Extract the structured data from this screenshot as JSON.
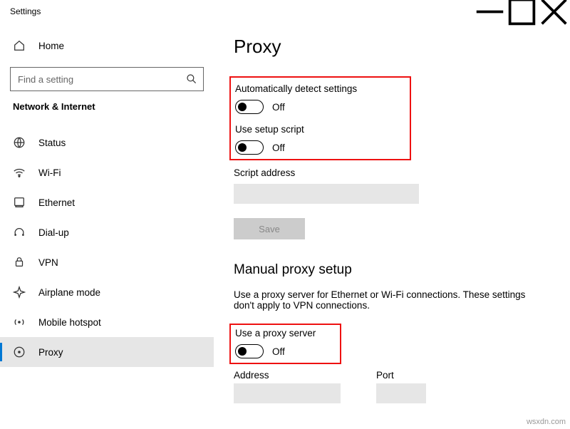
{
  "window": {
    "title": "Settings",
    "min": "minimize",
    "max": "maximize",
    "close": "close"
  },
  "sidebar": {
    "home": "Home",
    "search_placeholder": "Find a setting",
    "group": "Network & Internet",
    "items": [
      {
        "label": "Status"
      },
      {
        "label": "Wi-Fi"
      },
      {
        "label": "Ethernet"
      },
      {
        "label": "Dial-up"
      },
      {
        "label": "VPN"
      },
      {
        "label": "Airplane mode"
      },
      {
        "label": "Mobile hotspot"
      },
      {
        "label": "Proxy"
      }
    ]
  },
  "main": {
    "title": "Proxy",
    "auto": {
      "detect_label": "Automatically detect settings",
      "detect_state": "Off",
      "script_label": "Use setup script",
      "script_state": "Off",
      "addr_label": "Script address",
      "save": "Save"
    },
    "manual": {
      "heading": "Manual proxy setup",
      "desc": "Use a proxy server for Ethernet or Wi-Fi connections. These settings don't apply to VPN connections.",
      "use_label": "Use a proxy server",
      "use_state": "Off",
      "addr_label": "Address",
      "port_label": "Port"
    }
  },
  "watermark": "wsxdn.com"
}
